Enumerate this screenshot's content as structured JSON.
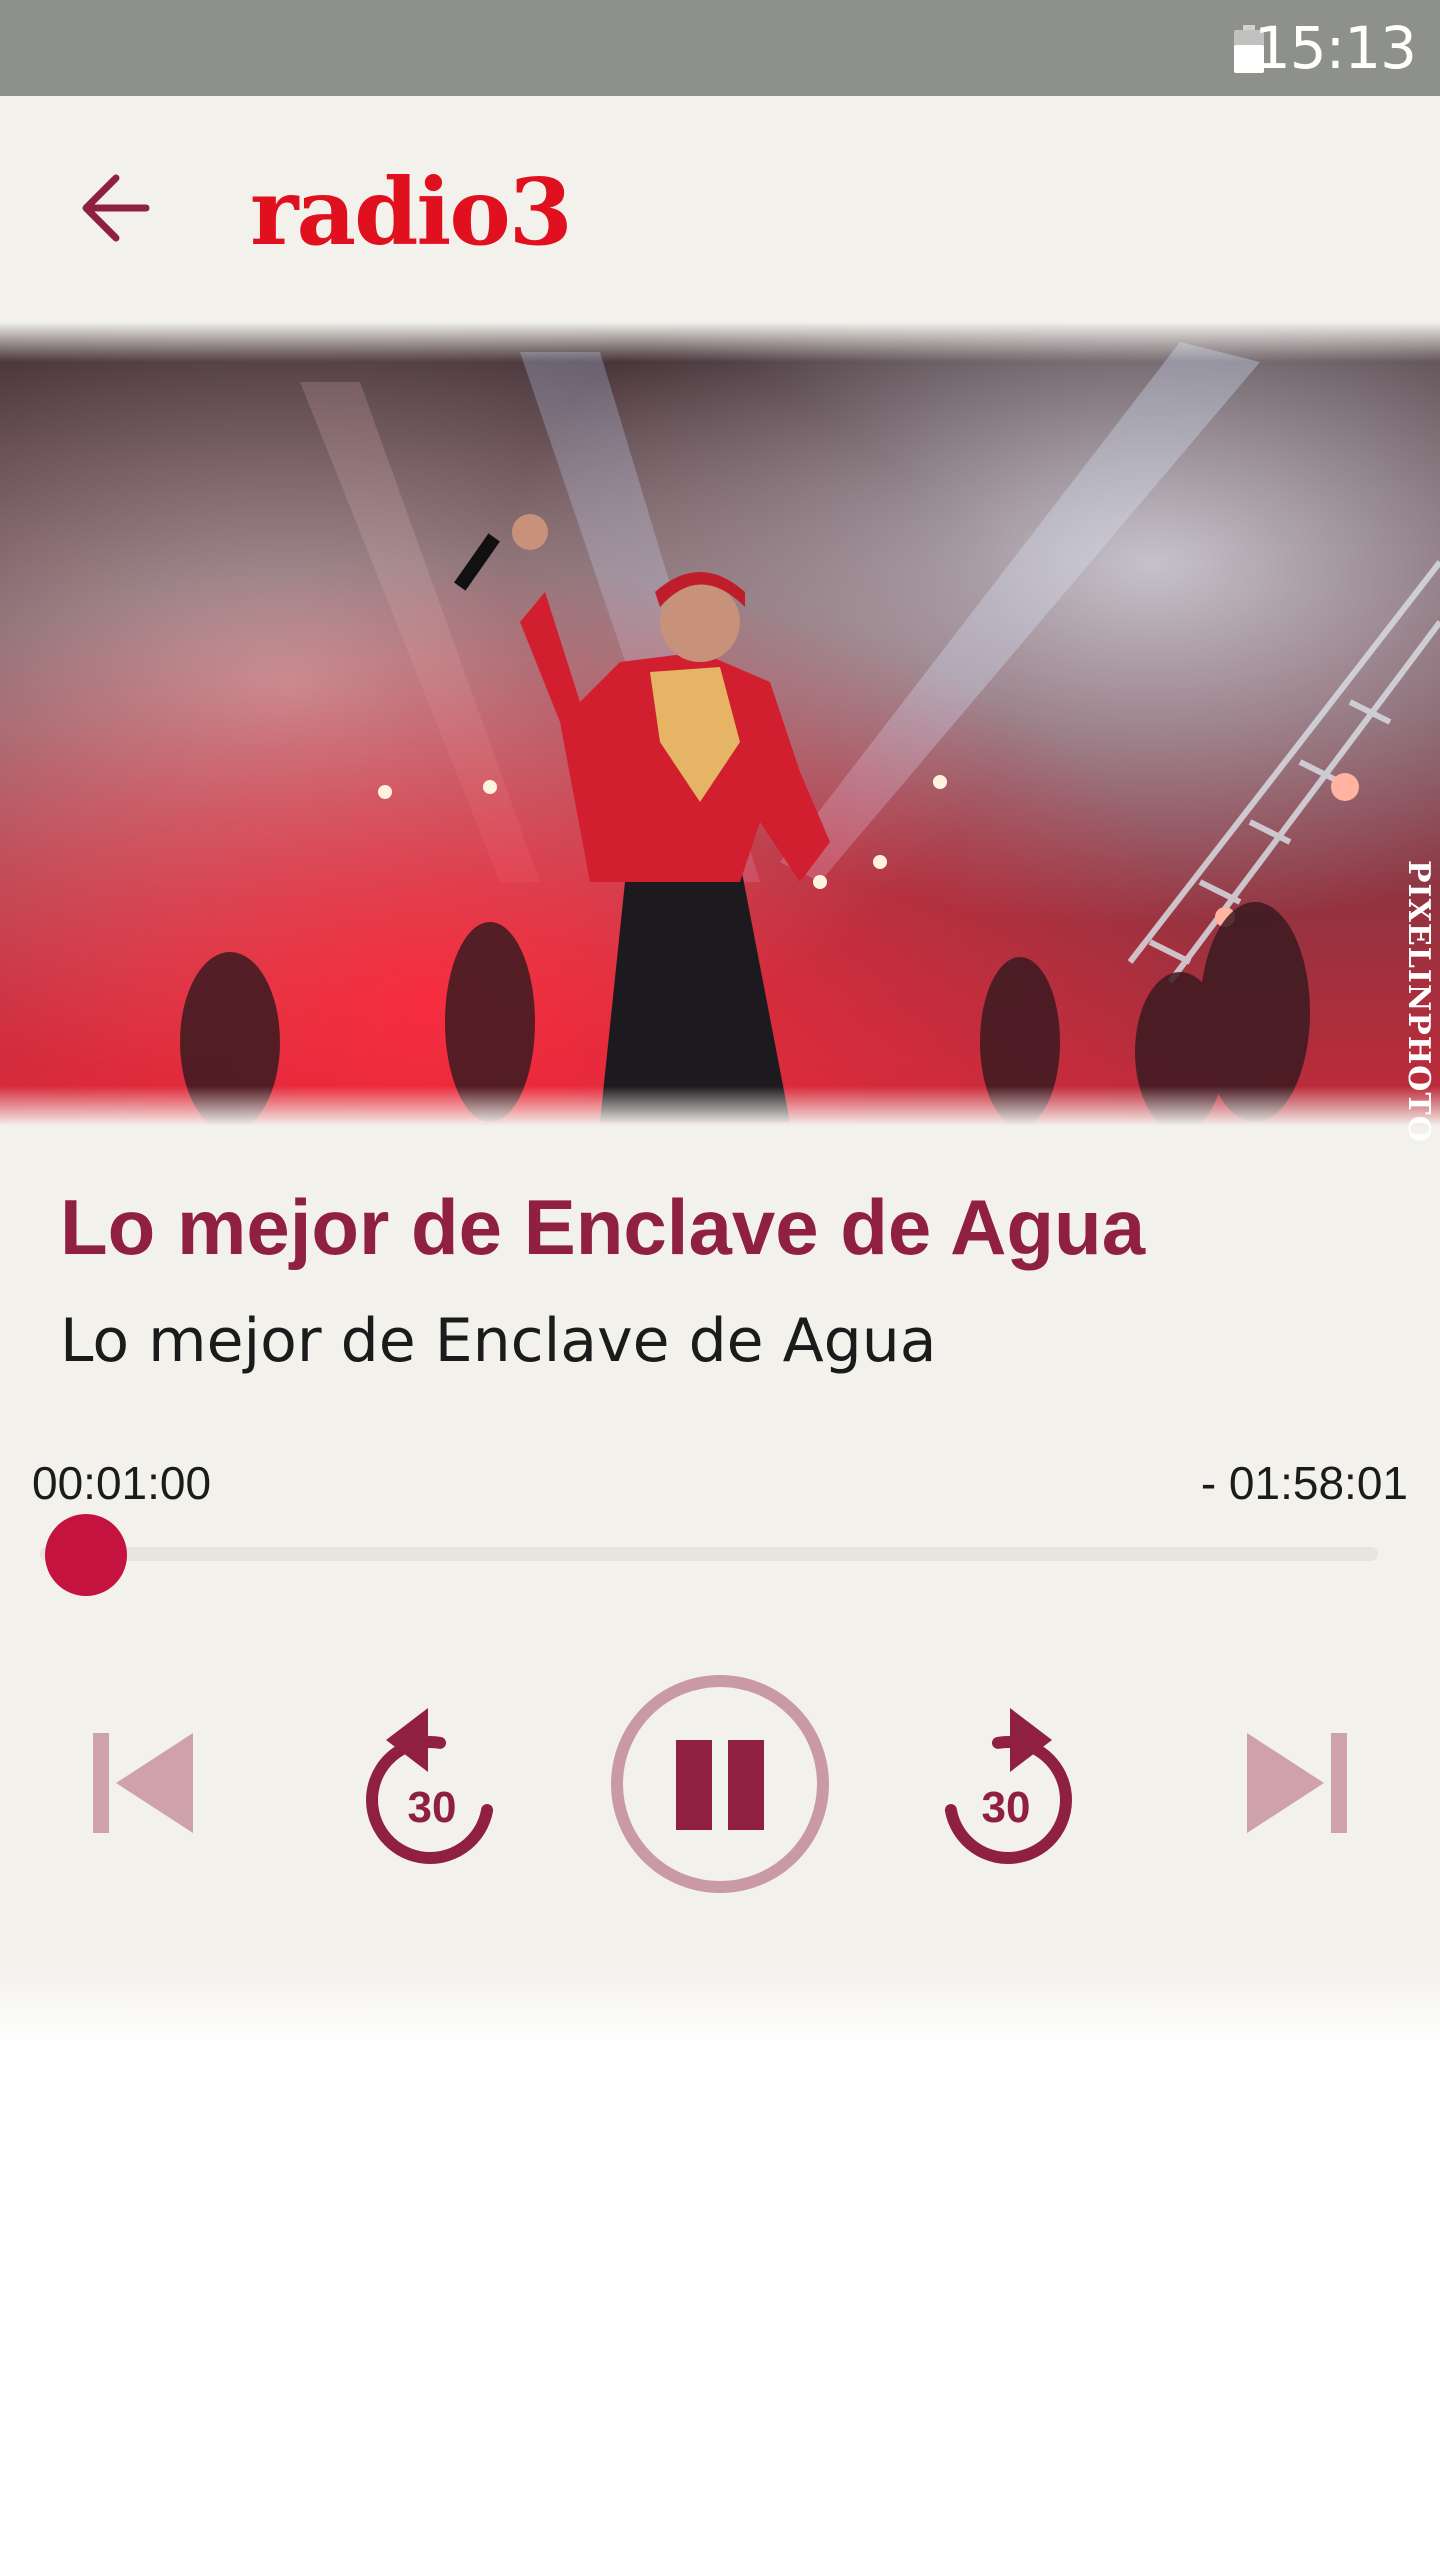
{
  "status_bar": {
    "time": "15:13",
    "icon": "battery-icon"
  },
  "toolbar": {
    "back_icon": "arrow-left-icon",
    "logo_text": "radio3",
    "brand_color": "#e0101e"
  },
  "hero": {
    "watermark": "PIXELINPHOTO"
  },
  "episode": {
    "title": "Lo mejor de Enclave de Agua",
    "subtitle": "Lo mejor de Enclave de Agua"
  },
  "player": {
    "elapsed": "00:01:00",
    "remaining": "- 01:58:01",
    "progress_fraction": 0.008,
    "rewind_label": "30",
    "forward_label": "30",
    "state": "playing",
    "accent_color": "#8f2044",
    "thumb_color": "#c5133f",
    "controls": [
      "skip-previous-icon",
      "rewind-30-icon",
      "pause-icon",
      "forward-30-icon",
      "skip-next-icon"
    ]
  }
}
